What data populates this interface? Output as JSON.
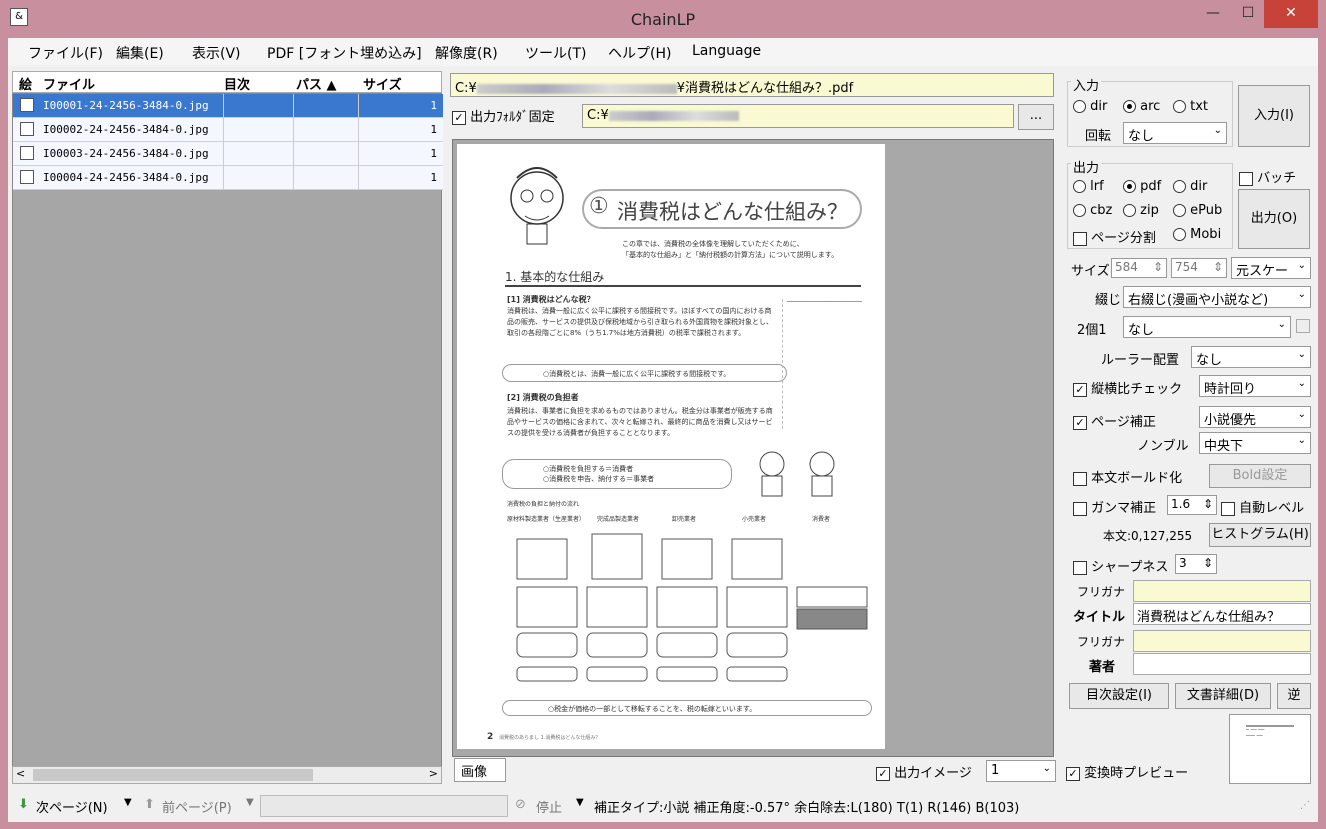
{
  "window": {
    "title": "ChainLP",
    "minimize": "—",
    "maximize": "☐",
    "close": "✕",
    "icon": "ChainLP"
  },
  "menu": [
    "ファイル(F)",
    "編集(E)",
    "表示(V)",
    "PDF [フォント埋め込み]",
    "解像度(R)",
    "ツール(T)",
    "ヘルプ(H)",
    "Language"
  ],
  "list": {
    "headers": [
      "絵",
      "ファイル",
      "目次",
      "パス ▲",
      "サイズ"
    ],
    "rows": [
      {
        "file": "I00001-24-2456-3484-0.jpg",
        "size": "1"
      },
      {
        "file": "I00002-24-2456-3484-0.jpg",
        "size": "1"
      },
      {
        "file": "I00003-24-2456-3484-0.jpg",
        "size": "1"
      },
      {
        "file": "I00004-24-2456-3484-0.jpg",
        "size": "1"
      }
    ]
  },
  "path": {
    "prefix": "C:¥",
    "suffix": "¥消費税はどんな仕組み？.pdf"
  },
  "outfolder": {
    "label": "出力ﾌｫﾙﾀﾞ固定",
    "prefix": "C:¥",
    "browse": "..."
  },
  "page": {
    "num": "①",
    "title": "消費税はどんな仕組み？",
    "intro1": "この章では、消費税の全体像を理解していただくために、",
    "intro2": "「基本的な仕組み」と「納付税額の計算方法」について説明します。",
    "section": "1. 基本的な仕組み",
    "s1": "[1] 消費税はどんな税？",
    "s2": "[2] 消費税の負担者",
    "p1": "消費税は、消費一般に広く公平に課税する間接税です。ほぼすべての国内における商品の販売、サービスの提供及び保税地域から引き取られる外国貨物を課税対象とし、取引の各段階ごとに8%（うち1.7%は地方消費税）の税率で課税されます。",
    "p2": "消費税は、事業者に負担を求めるものではありません。税金分は事業者が販売する商品やサービスの価格に含まれて、次々と転嫁され、最終的に商品を消費し又はサービスの提供を受ける消費者が負担することとなります。",
    "point1": "○消費税とは、消費一般に広く公平に課税する間接税です。",
    "point2a": "○消費税を負担する＝消費者",
    "point2b": "○消費税を申告、納付する＝事業者",
    "flowtitle": "消費税の負担と納付の流れ",
    "actors": [
      "原材料製造業者（生産業者）",
      "完成品製造業者",
      "卸売業者",
      "小売業者",
      "消費者"
    ],
    "point3": "○税金が価格の一部として移転することを、税の転嫁といいます。",
    "footer": "消費税のあらまし 1.消費税はどんな仕組み？",
    "pageno": "2"
  },
  "tabs": {
    "image": "画像",
    "outimage": "出力イメージ",
    "outimage_val": "1",
    "preview": "変換時プレビュー"
  },
  "right": {
    "input_group": "入力",
    "in_dir": "dir",
    "in_arc": "arc",
    "in_txt": "txt",
    "rotate_label": "回転",
    "rotate_val": "なし",
    "input_btn": "入力(I)",
    "output_group": "出力",
    "batch": "バッチ",
    "out_lrf": "lrf",
    "out_pdf": "pdf",
    "out_dir": "dir",
    "out_cbz": "cbz",
    "out_zip": "zip",
    "out_epub": "ePub",
    "page_split": "ページ分割",
    "out_mobi": "Mobi",
    "output_btn": "出力(O)",
    "size_label": "サイズ",
    "size_w": "584",
    "size_h": "754",
    "size_mode": "元スケー",
    "binding_label": "綴じ",
    "binding_val": "右綴じ(漫画や小説など)",
    "twoinone_label": "2個1",
    "twoinone_val": "なし",
    "ruler_label": "ルーラー配置",
    "ruler_val": "なし",
    "aspect_label": "縦横比チェック",
    "aspect_val": "時計回り",
    "pagefix_label": "ページ補正",
    "pagefix_val": "小説優先",
    "nombre_label": "ノンブル",
    "nombre_val": "中央下",
    "bold_label": "本文ボールド化",
    "bold_btn": "Bold設定",
    "gamma_label": "ガンマ補正",
    "gamma_val": "1.6",
    "autolevel": "自動レベル",
    "body_label": "本文:0,127,255",
    "histogram_btn": "ヒストグラム(H)",
    "sharp_label": "シャープネス",
    "sharp_val": "3",
    "furigana1": "フリガナ",
    "title_label": "タイトル",
    "title_val": "消費税はどんな仕組み？",
    "furigana2": "フリガナ",
    "author_label": "著者",
    "toc_btn": "目次設定(I)",
    "doc_btn": "文書詳細(D)",
    "rev_btn": "逆"
  },
  "status": {
    "next": "次ページ(N)",
    "prev": "前ページ(P)",
    "stop": "停止",
    "info": "補正タイプ:小説 補正角度:-0.57° 余白除去:L(180) T(1) R(146) B(103)"
  }
}
